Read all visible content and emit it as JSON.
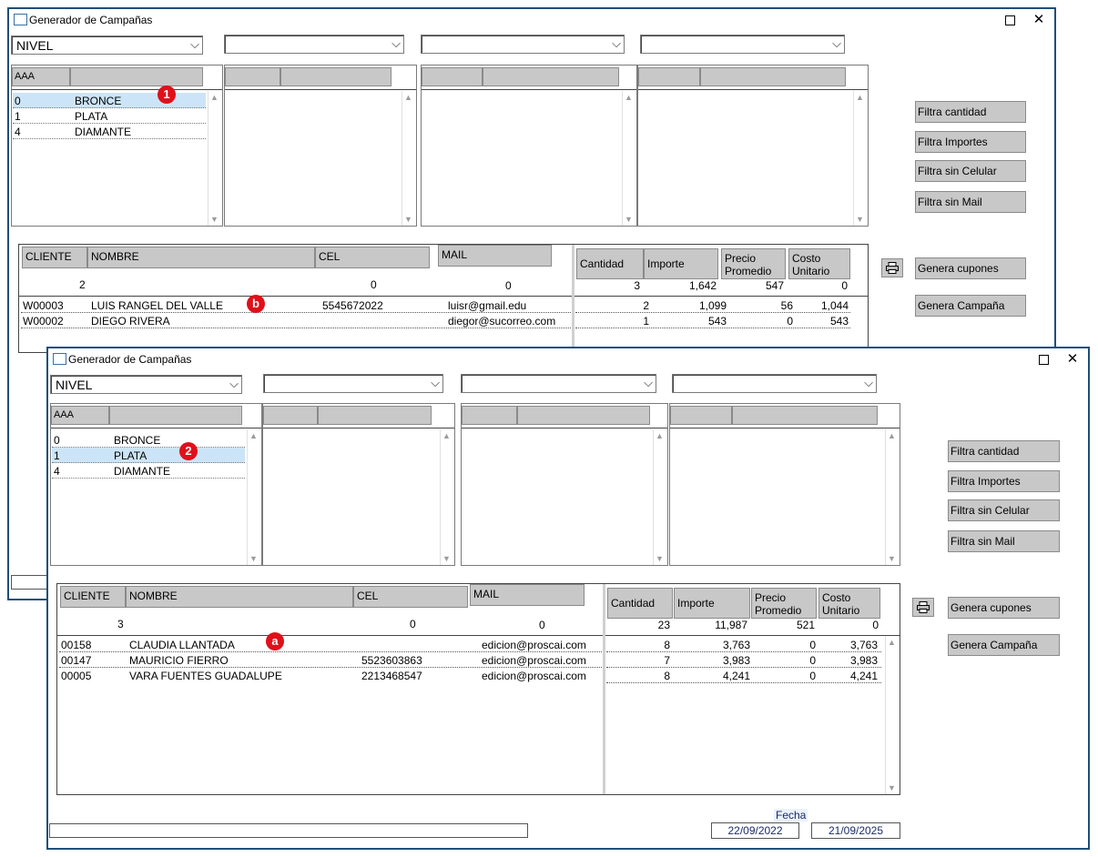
{
  "win1": {
    "title": "Generador de Campañas",
    "combos": [
      "NIVEL",
      "",
      "",
      ""
    ],
    "list": {
      "header": "AAA",
      "rows": [
        {
          "code": "0",
          "name": "BRONCE",
          "selected": true
        },
        {
          "code": "1",
          "name": "PLATA",
          "selected": false
        },
        {
          "code": "4",
          "name": "DIAMANTE",
          "selected": false
        }
      ]
    },
    "buttons": {
      "filtra_cantidad": "Filtra cantidad",
      "filtra_importes": "Filtra Importes",
      "filtra_sin_celular": "Filtra sin Celular",
      "filtra_sin_mail": "Filtra sin Mail",
      "genera_cupones": "Genera cupones",
      "genera_campana": "Genera Campaña"
    },
    "grid": {
      "headers": {
        "cliente": "CLIENTE",
        "nombre": "NOMBRE",
        "cel": "CEL",
        "mail": "MAIL",
        "cantidad": "Cantidad",
        "importe": "Importe",
        "precio": "Precio Promedio",
        "costo": "Costo Unitario"
      },
      "totals": {
        "clientes": "2",
        "cel": "0",
        "mail": "0",
        "cantidad": "3",
        "importe": "1,642",
        "precio": "547",
        "costo": "0"
      },
      "rows": [
        {
          "cliente": "W00003",
          "nombre": "LUIS RANGEL DEL VALLE",
          "cel": "5545672022",
          "mail": "luisr@gmail.edu",
          "cantidad": "2",
          "importe": "1,099",
          "precio": "56",
          "costo": "1,044"
        },
        {
          "cliente": "W00002",
          "nombre": "DIEGO RIVERA",
          "cel": "",
          "mail": "diegor@sucorreo.com",
          "cantidad": "1",
          "importe": "543",
          "precio": "0",
          "costo": "543"
        }
      ]
    },
    "badge_list": "1",
    "badge_grid": "b"
  },
  "win2": {
    "title": "Generador de Campañas",
    "combos": [
      "NIVEL",
      "",
      "",
      ""
    ],
    "list": {
      "header": "AAA",
      "rows": [
        {
          "code": "0",
          "name": "BRONCE",
          "selected": false
        },
        {
          "code": "1",
          "name": "PLATA",
          "selected": true
        },
        {
          "code": "4",
          "name": "DIAMANTE",
          "selected": false
        }
      ]
    },
    "buttons": {
      "filtra_cantidad": "Filtra cantidad",
      "filtra_importes": "Filtra Importes",
      "filtra_sin_celular": "Filtra sin Celular",
      "filtra_sin_mail": "Filtra sin Mail",
      "genera_cupones": "Genera cupones",
      "genera_campana": "Genera Campaña"
    },
    "grid": {
      "headers": {
        "cliente": "CLIENTE",
        "nombre": "NOMBRE",
        "cel": "CEL",
        "mail": "MAIL",
        "cantidad": "Cantidad",
        "importe": "Importe",
        "precio": "Precio Promedio",
        "costo": "Costo Unitario"
      },
      "totals": {
        "clientes": "3",
        "cel": "0",
        "mail": "0",
        "cantidad": "23",
        "importe": "11,987",
        "precio": "521",
        "costo": "0"
      },
      "rows": [
        {
          "cliente": "00158",
          "nombre": "CLAUDIA LLANTADA",
          "cel": "",
          "mail": "edicion@proscai.com",
          "cantidad": "8",
          "importe": "3,763",
          "precio": "0",
          "costo": "3,763"
        },
        {
          "cliente": "00147",
          "nombre": "MAURICIO FIERRO",
          "cel": "5523603863",
          "mail": "edicion@proscai.com",
          "cantidad": "7",
          "importe": "3,983",
          "precio": "0",
          "costo": "3,983"
        },
        {
          "cliente": "00005",
          "nombre": "VARA FUENTES GUADALUPE",
          "cel": "2213468547",
          "mail": "edicion@proscai.com",
          "cantidad": "8",
          "importe": "4,241",
          "precio": "0",
          "costo": "4,241"
        }
      ]
    },
    "fecha_label": "Fecha",
    "fecha_desde": "22/09/2022",
    "fecha_hasta": "21/09/2025",
    "badge_list": "2",
    "badge_grid": "a"
  }
}
